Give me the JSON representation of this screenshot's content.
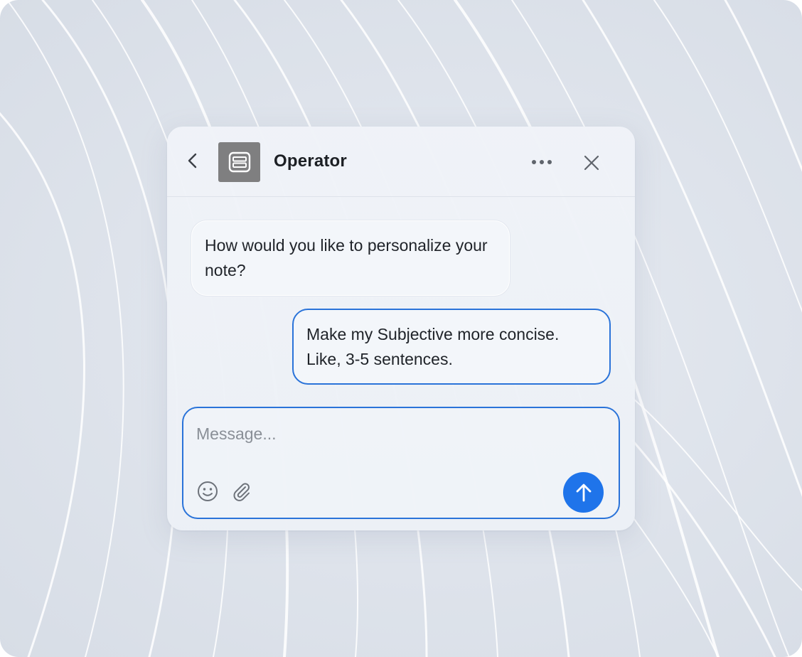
{
  "header": {
    "title": "Operator",
    "back_icon": "chevron-left-icon",
    "avatar_icon": "operator-card-icon",
    "more_icon": "more-horizontal-icon",
    "close_icon": "close-icon"
  },
  "messages": [
    {
      "role": "assistant",
      "text": "How would you like to personalize your note?"
    },
    {
      "role": "user",
      "text": "Make my Subjective more concise. Like, 3-5 sentences."
    }
  ],
  "composer": {
    "placeholder": "Message...",
    "value": "",
    "emoji_icon": "smiley-icon",
    "attach_icon": "paperclip-icon",
    "send_icon": "arrow-up-icon"
  },
  "colors": {
    "accent": "#1f74ea",
    "border_accent": "#2a73d9",
    "avatar_bg": "#7f7f80",
    "text_primary": "#1f2329"
  }
}
